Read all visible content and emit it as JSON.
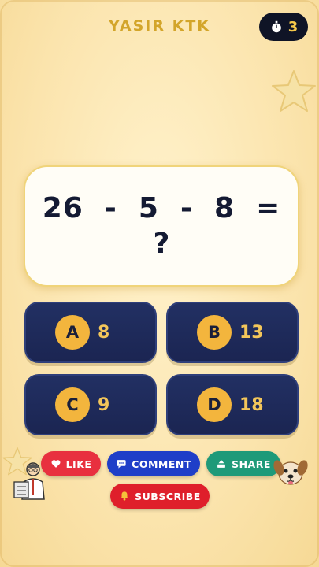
{
  "header": {
    "title": "YASIR KTK",
    "timer_value": "3"
  },
  "question": {
    "line1": "26  -  5  -  8  =",
    "line2": "?"
  },
  "options": [
    {
      "letter": "A",
      "value": "8"
    },
    {
      "letter": "B",
      "value": "13"
    },
    {
      "letter": "C",
      "value": "9"
    },
    {
      "letter": "D",
      "value": "18"
    }
  ],
  "actions": {
    "like": "LIKE",
    "comment": "COMMENT",
    "share": "SHARE",
    "subscribe": "SUBSCRIBE"
  },
  "colors": {
    "background": "#fbe7b3",
    "title": "#d3a52a",
    "option_bg": "#1b2552",
    "option_badge": "#f3b53d",
    "like": "#e8303f",
    "comment": "#1f3ec8",
    "share": "#1e9a79",
    "subscribe": "#df1f2b"
  },
  "icons": [
    "stopwatch-icon",
    "star-icon",
    "heart-icon",
    "chat-icon",
    "share-icon",
    "bell-icon",
    "teacher-mascot-icon",
    "dog-mascot-icon"
  ]
}
